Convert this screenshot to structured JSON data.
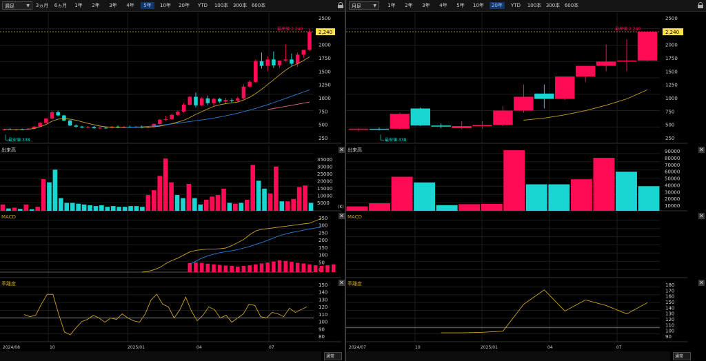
{
  "left": {
    "period_select": "週足",
    "range_buttons": [
      "3ヵ月",
      "6ヵ月",
      "1年",
      "2年",
      "3年",
      "4年",
      "5年",
      "10年",
      "20年",
      "YTD",
      "100本",
      "300本",
      "600本"
    ],
    "active_range": "5年",
    "price_axis": [
      "2500",
      "2250",
      "2000",
      "1750",
      "1500",
      "1250",
      "1000",
      "750",
      "500",
      "250"
    ],
    "last_price": "2,240",
    "high_label": "最高値:2,240",
    "low_label": "最安値:338",
    "volume_title": "出来高",
    "volume_axis": [
      "35000",
      "30000",
      "25000",
      "20000",
      "15000",
      "10000",
      "5000"
    ],
    "volume_unit": "(K)",
    "macd_title": "MACD",
    "macd_axis": [
      "350",
      "300",
      "250",
      "200",
      "150",
      "100",
      "50",
      "0"
    ],
    "rsi_title": "乖離度",
    "rsi_axis": [
      "150",
      "140",
      "130",
      "120",
      "110",
      "100",
      "90",
      "80"
    ],
    "time_axis": [
      "2024/08",
      "10",
      "2025/01",
      "04",
      "07"
    ],
    "footer_select": "通常"
  },
  "right": {
    "period_select": "月足",
    "range_buttons": [
      "1年",
      "2年",
      "3年",
      "4年",
      "5年",
      "10年",
      "20年",
      "YTD",
      "100本",
      "300本",
      "600本"
    ],
    "active_range": "20年",
    "price_axis": [
      "2500",
      "2250",
      "2000",
      "1750",
      "1500",
      "1250",
      "1000",
      "750",
      "500",
      "250"
    ],
    "last_price": "2,240",
    "high_label": "最高値:2,240",
    "low_label": "最安値:338",
    "volume_title": "出来高",
    "volume_axis": [
      "90000",
      "80000",
      "70000",
      "60000",
      "50000",
      "40000",
      "30000",
      "20000",
      "10000"
    ],
    "macd_title": "MACD",
    "rsi_title": "乖離度",
    "rsi_axis": [
      "180",
      "170",
      "160",
      "150",
      "140",
      "130",
      "120",
      "110",
      "100",
      "90"
    ],
    "time_axis": [
      "2024/07",
      "10",
      "2025/01",
      "04",
      "07"
    ],
    "footer_select": "通常"
  },
  "colors": {
    "up": "#ff0a54",
    "down": "#19d6d2",
    "ma_short": "#c9a227",
    "ma_long": "#2f7fd6",
    "ma_mid": "#e07080",
    "highlight": "#ffe14d"
  },
  "chart_data": [
    {
      "type": "candlestick",
      "name_hint": "weekly",
      "ylim": [
        250,
        2500
      ],
      "candles": [
        [
          400,
          420,
          380,
          410
        ],
        [
          410,
          430,
          395,
          400
        ],
        [
          400,
          415,
          385,
          408
        ],
        [
          408,
          425,
          398,
          405
        ],
        [
          405,
          430,
          398,
          422
        ],
        [
          422,
          470,
          415,
          460
        ],
        [
          460,
          540,
          450,
          530
        ],
        [
          530,
          620,
          520,
          610
        ],
        [
          610,
          760,
          600,
          730
        ],
        [
          730,
          760,
          650,
          670
        ],
        [
          670,
          680,
          560,
          575
        ],
        [
          575,
          590,
          470,
          480
        ],
        [
          480,
          500,
          440,
          460
        ],
        [
          460,
          475,
          430,
          445
        ],
        [
          445,
          470,
          430,
          450
        ],
        [
          450,
          470,
          420,
          430
        ],
        [
          430,
          450,
          415,
          440
        ],
        [
          440,
          460,
          420,
          435
        ],
        [
          435,
          470,
          425,
          460
        ],
        [
          460,
          480,
          430,
          440
        ],
        [
          440,
          470,
          430,
          455
        ],
        [
          455,
          480,
          440,
          445
        ],
        [
          445,
          470,
          430,
          460
        ],
        [
          460,
          480,
          430,
          440
        ],
        [
          440,
          470,
          430,
          450
        ],
        [
          450,
          520,
          440,
          510
        ],
        [
          510,
          600,
          500,
          590
        ],
        [
          590,
          660,
          570,
          600
        ],
        [
          600,
          700,
          590,
          680
        ],
        [
          680,
          760,
          660,
          740
        ],
        [
          740,
          900,
          720,
          870
        ],
        [
          870,
          1030,
          860,
          1020
        ],
        [
          1020,
          1100,
          820,
          860
        ],
        [
          860,
          1010,
          840,
          990
        ],
        [
          990,
          1040,
          860,
          900
        ],
        [
          900,
          1000,
          850,
          980
        ],
        [
          980,
          1000,
          900,
          930
        ],
        [
          930,
          1000,
          890,
          960
        ],
        [
          960,
          990,
          900,
          950
        ],
        [
          950,
          1020,
          920,
          990
        ],
        [
          990,
          1250,
          970,
          1210
        ],
        [
          1210,
          1330,
          1190,
          1300
        ],
        [
          1300,
          1720,
          1280,
          1690
        ],
        [
          1690,
          1850,
          1550,
          1600
        ],
        [
          1600,
          1780,
          1500,
          1720
        ],
        [
          1720,
          1870,
          1560,
          1610
        ],
        [
          1610,
          1700,
          1560,
          1700
        ],
        [
          1700,
          2000,
          1680,
          1720
        ],
        [
          1720,
          1830,
          1600,
          1640
        ],
        [
          1640,
          1850,
          1580,
          1810
        ],
        [
          1810,
          1900,
          1750,
          1900
        ],
        [
          1900,
          2300,
          1880,
          2240
        ]
      ],
      "ma_short": [
        410,
        405,
        404,
        405,
        410,
        425,
        455,
        500,
        560,
        600,
        610,
        600,
        580,
        550,
        520,
        495,
        470,
        455,
        448,
        445,
        444,
        445,
        446,
        447,
        448,
        455,
        470,
        490,
        515,
        545,
        580,
        630,
        690,
        740,
        790,
        840,
        870,
        890,
        905,
        920,
        960,
        1010,
        1080,
        1160,
        1250,
        1340,
        1430,
        1520,
        1590,
        1640,
        1700,
        1770
      ],
      "ma_long_start": 20,
      "ma_long": [
        440,
        445,
        450,
        456,
        463,
        472,
        483,
        496,
        510,
        525,
        540,
        555,
        570,
        585,
        602,
        620,
        640,
        662,
        686,
        712,
        740,
        770,
        802,
        836,
        872,
        910,
        950,
        990,
        1030,
        1070,
        1110,
        1150
      ],
      "ma_mid_start": 44,
      "ma_mid": [
        780,
        800,
        820,
        840,
        860,
        880,
        900,
        920
      ]
    },
    {
      "type": "bar",
      "name_hint": "weekly-volume",
      "ylim": [
        0,
        37000
      ],
      "values": [
        4000,
        1500,
        2000,
        1200,
        4000,
        1000,
        2500,
        20000,
        18000,
        26000,
        8000,
        5000,
        5000,
        4500,
        4000,
        3500,
        3000,
        3500,
        2500,
        3000,
        2500,
        2500,
        3000,
        3000,
        2500,
        10000,
        13000,
        22000,
        33000,
        18000,
        10000,
        8000,
        17000,
        8000,
        4000,
        7000,
        9000,
        10000,
        14000,
        5000,
        4500,
        5000,
        7000,
        29000,
        19000,
        14000,
        11000,
        28000,
        6000,
        6000,
        7500,
        15000,
        16000,
        5000
      ],
      "up": [
        1,
        0,
        1,
        0,
        1,
        0,
        1,
        1,
        0,
        0,
        0,
        0,
        0,
        0,
        0,
        0,
        0,
        0,
        0,
        0,
        0,
        0,
        0,
        0,
        0,
        1,
        1,
        1,
        1,
        1,
        0,
        0,
        1,
        0,
        0,
        1,
        1,
        1,
        1,
        0,
        1,
        0,
        1,
        1,
        0,
        0,
        1,
        1,
        0,
        1,
        1,
        1,
        1,
        0
      ]
    },
    {
      "type": "bar",
      "name_hint": "weekly-macd",
      "ylim": [
        0,
        350
      ],
      "histogram_start": 31,
      "histogram": [
        58,
        62,
        60,
        54,
        50,
        46,
        42,
        40,
        36,
        40,
        44,
        50,
        56,
        62,
        68,
        76,
        72,
        66,
        60,
        56,
        50,
        44,
        40,
        44,
        50
      ],
      "macd_line_start": 23,
      "macd_line": [
        0,
        5,
        15,
        30,
        55,
        75,
        90,
        110,
        130,
        140,
        145,
        148,
        148,
        150,
        155,
        170,
        190,
        210,
        240,
        265,
        275,
        280,
        285,
        290,
        295,
        300,
        305,
        310,
        315,
        330,
        345
      ],
      "signal_line_start": 31,
      "signal_line": [
        50,
        70,
        90,
        105,
        115,
        125,
        132,
        138,
        145,
        155,
        165,
        178,
        190,
        205,
        220,
        235,
        245,
        255,
        262,
        270,
        278,
        284,
        290
      ]
    },
    {
      "type": "line",
      "name_hint": "weekly-divergence",
      "ylim": [
        70,
        150
      ],
      "baseline": 100,
      "values": [
        105,
        102,
        104,
        120,
        134,
        134,
        105,
        80,
        76,
        86,
        95,
        98,
        104,
        100,
        94,
        100,
        98,
        106,
        100,
        96,
        94,
        106,
        126,
        134,
        120,
        116,
        100,
        112,
        130,
        110,
        96,
        104,
        116,
        112,
        100,
        104,
        94,
        100,
        106,
        120,
        118,
        102,
        100,
        108,
        106,
        102,
        114,
        108,
        112,
        116
      ]
    },
    {
      "type": "candlestick",
      "name_hint": "monthly",
      "ylim": [
        250,
        2500
      ],
      "candles": [
        [
          400,
          430,
          370,
          420
        ],
        [
          420,
          440,
          390,
          405
        ],
        [
          420,
          720,
          410,
          700
        ],
        [
          800,
          820,
          470,
          480
        ],
        [
          480,
          520,
          430,
          460
        ],
        [
          430,
          560,
          410,
          470
        ],
        [
          470,
          560,
          420,
          490
        ],
        [
          490,
          850,
          470,
          760
        ],
        [
          760,
          1250,
          720,
          1020
        ],
        [
          1080,
          1250,
          800,
          980
        ],
        [
          980,
          1400,
          960,
          1400
        ],
        [
          1400,
          1600,
          1300,
          1600
        ],
        [
          1600,
          2000,
          1500,
          1680
        ],
        [
          1680,
          2100,
          1500,
          1700
        ],
        [
          1700,
          2240,
          1690,
          2240
        ]
      ],
      "ma": [
        null,
        null,
        null,
        null,
        null,
        null,
        null,
        null,
        580,
        620,
        680,
        760,
        860,
        980,
        1150
      ]
    },
    {
      "type": "bar",
      "name_hint": "monthly-volume",
      "ylim": [
        0,
        95000
      ],
      "values": [
        7000,
        12000,
        54000,
        45000,
        9000,
        10500,
        11000,
        96000,
        42000,
        42000,
        50000,
        84000,
        62000,
        39000
      ],
      "up": [
        1,
        1,
        1,
        0,
        0,
        1,
        1,
        1,
        0,
        0,
        1,
        1,
        0,
        0
      ]
    },
    {
      "type": "line",
      "name_hint": "monthly-divergence",
      "ylim": [
        80,
        180
      ],
      "baseline": 100,
      "values": [
        null,
        null,
        null,
        null,
        91,
        91,
        92,
        94,
        142,
        168,
        130,
        150,
        140,
        125,
        145
      ]
    }
  ]
}
